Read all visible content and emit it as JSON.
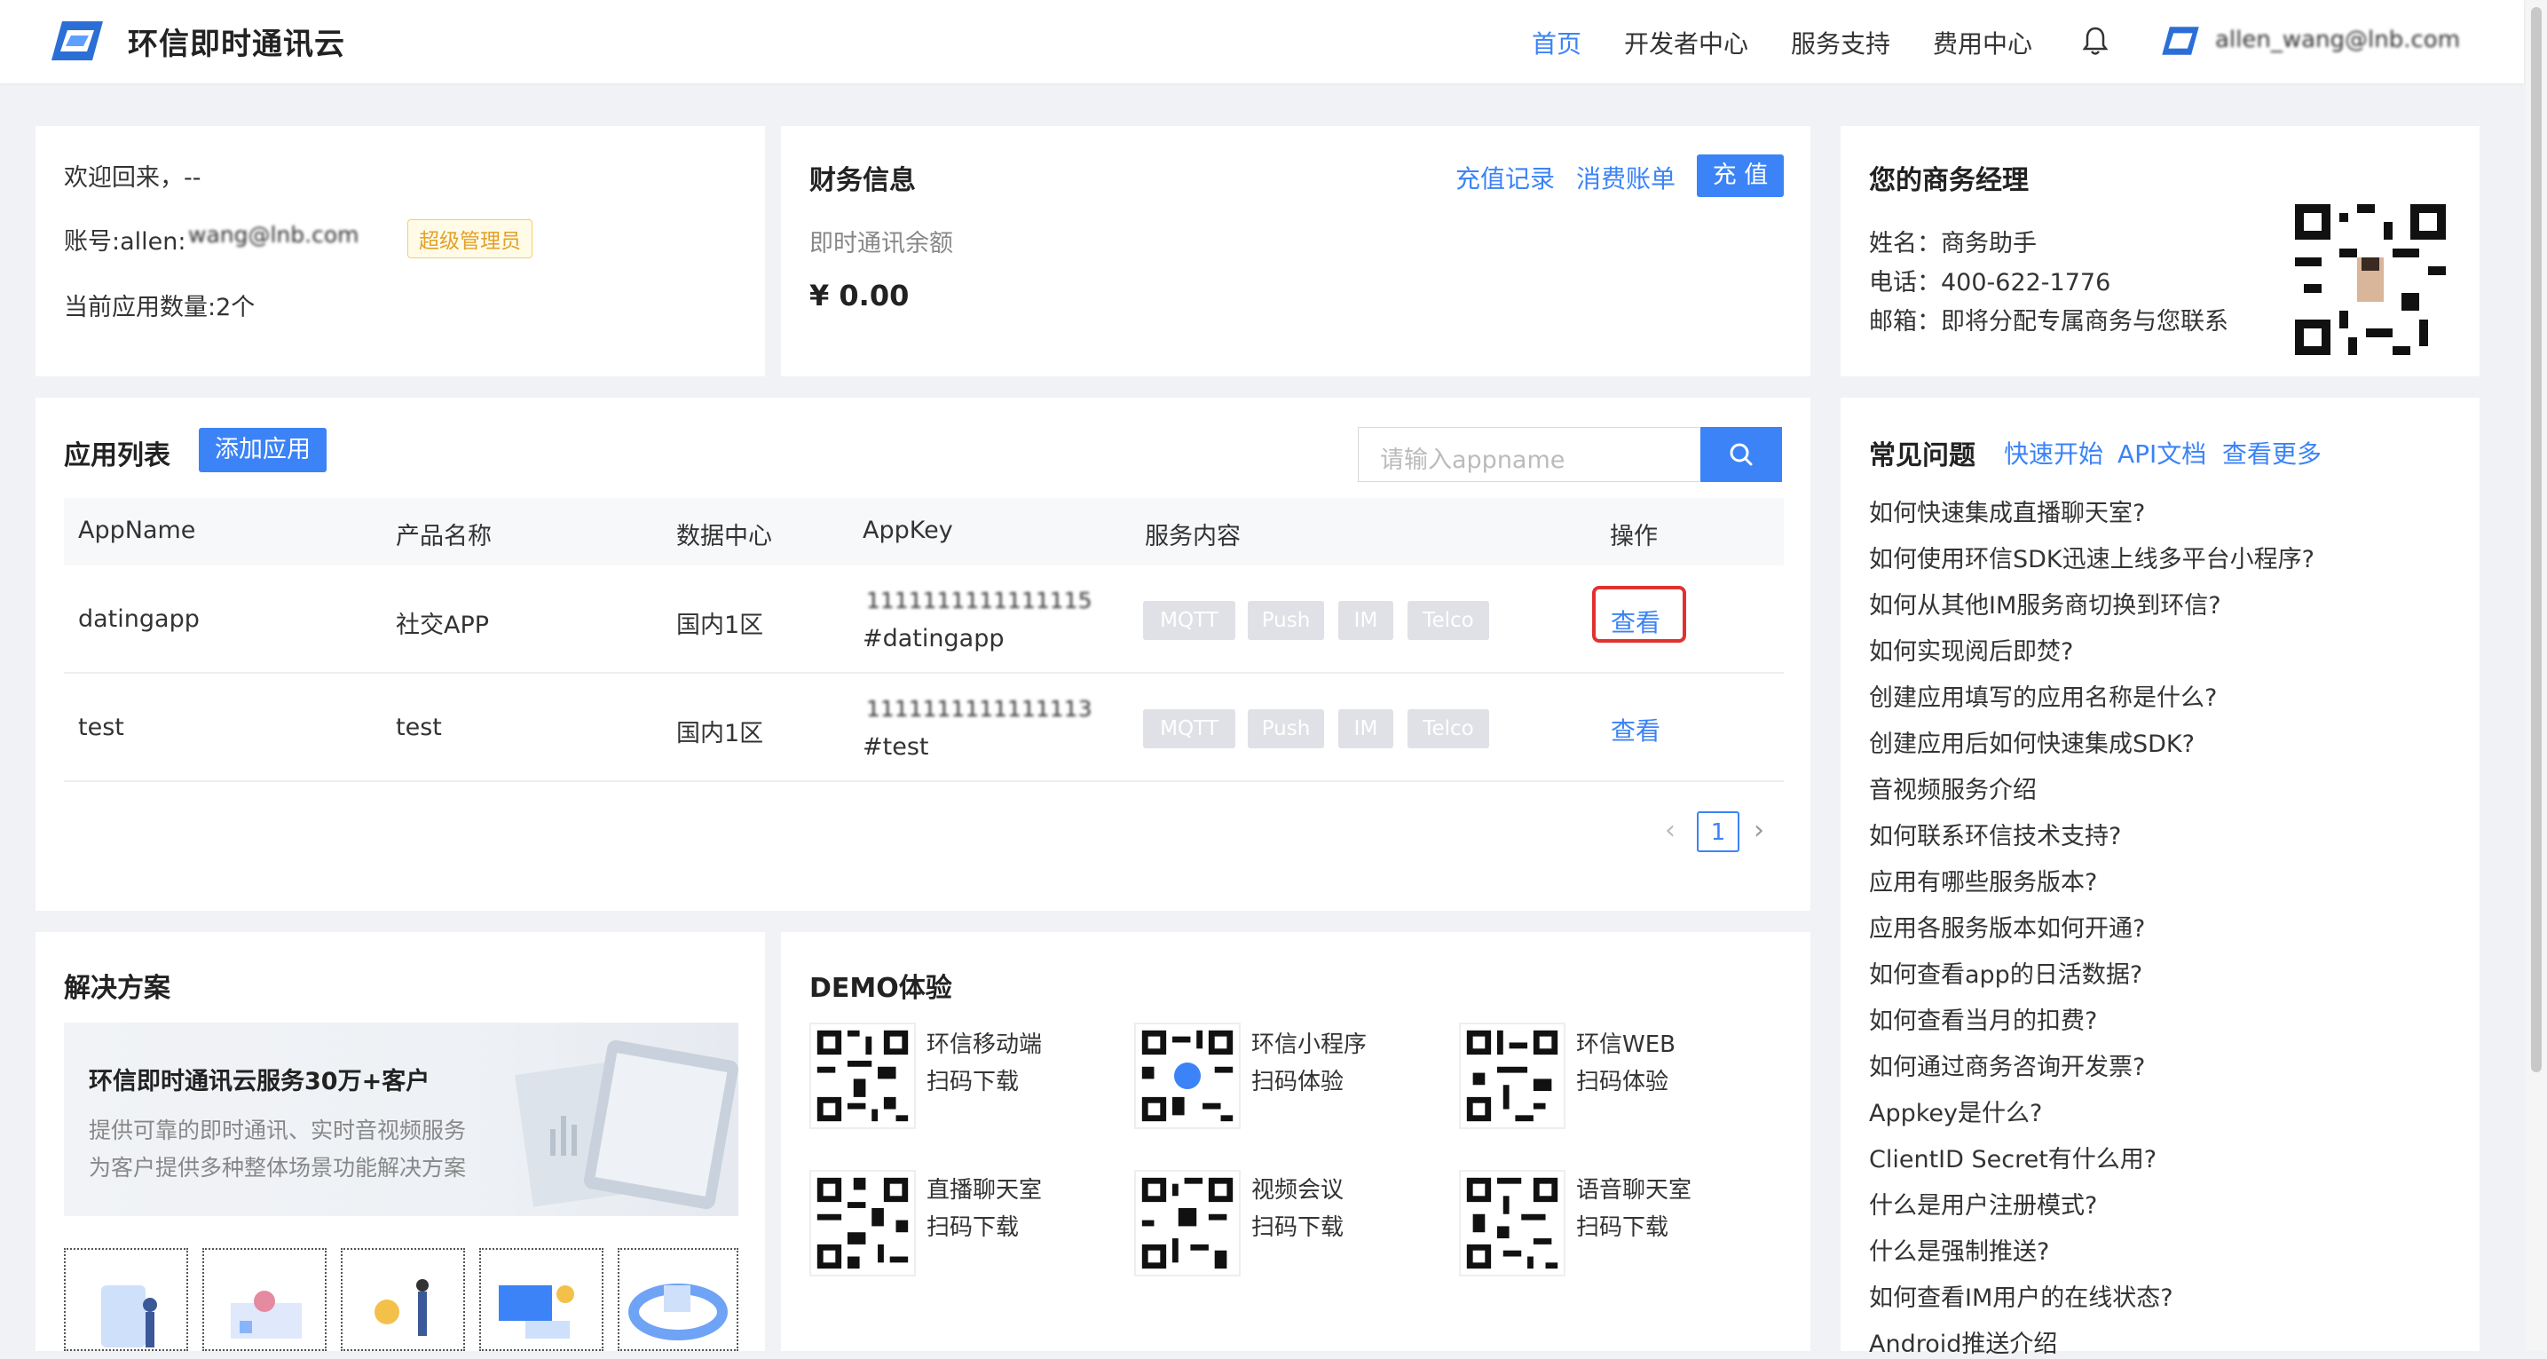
{
  "header": {
    "brand": "环信即时通讯云",
    "nav": [
      "首页",
      "开发者中心",
      "服务支持",
      "费用中心"
    ],
    "user": "allen_wang@lnb.com"
  },
  "welcome": {
    "greeting": "欢迎回来，--",
    "account_label": "账号:allen:",
    "account_value": "wang@lnb.com",
    "role_badge": "超级管理员",
    "app_count": "当前应用数量:2个"
  },
  "finance": {
    "title": "财务信息",
    "recharge_record": "充值记录",
    "bill": "消费账单",
    "recharge_button": "充 值",
    "balance_label": "即时通讯余额",
    "balance": "¥ 0.00"
  },
  "manager": {
    "title": "您的商务经理",
    "name": "姓名：商务助手",
    "phone": "电话：400-622-1776",
    "email": "邮箱：即将分配专属商务与您联系"
  },
  "apps": {
    "title": "应用列表",
    "add_button": "添加应用",
    "search_placeholder": "请输入appname",
    "columns": [
      "AppName",
      "产品名称",
      "数据中心",
      "AppKey",
      "服务内容",
      "操作"
    ],
    "rows": [
      {
        "name": "datingapp",
        "product": "社交APP",
        "dc": "国内1区",
        "key_line1": "1111111111111115",
        "key_line2": "#datingapp",
        "services": [
          "MQTT",
          "Push",
          "IM",
          "Telco"
        ],
        "action": "查看"
      },
      {
        "name": "test",
        "product": "test",
        "dc": "国内1区",
        "key_line1": "1111111111111113",
        "key_line2": "#test",
        "services": [
          "MQTT",
          "Push",
          "IM",
          "Telco"
        ],
        "action": "查看"
      }
    ],
    "page": "1"
  },
  "faq": {
    "title": "常见问题",
    "links": [
      "快速开始",
      "API文档",
      "查看更多"
    ],
    "items": [
      "如何快速集成直播聊天室?",
      "如何使用环信SDK迅速上线多平台小程序?",
      "如何从其他IM服务商切换到环信?",
      "如何实现阅后即焚?",
      "创建应用填写的应用名称是什么?",
      "创建应用后如何快速集成SDK?",
      "音视频服务介绍",
      "如何联系环信技术支持?",
      "应用有哪些服务版本?",
      "应用各服务版本如何开通?",
      "如何查看app的日活数据?",
      "如何查看当月的扣费?",
      "如何通过商务咨询开发票?",
      "Appkey是什么?",
      "ClientID Secret有什么用?",
      "什么是用户注册模式?",
      "什么是强制推送?",
      "如何查看IM用户的在线状态?",
      "Android推送介绍"
    ]
  },
  "solutions": {
    "title": "解决方案",
    "banner_title": "环信即时通讯云服务30万+客户",
    "banner_line1": "提供可靠的即时通讯、实时音视频服务",
    "banner_line2": "为客户提供多种整体场景功能解决方案"
  },
  "demo": {
    "title": "DEMO体验",
    "items": [
      {
        "name": "环信移动端",
        "action": "扫码下载"
      },
      {
        "name": "环信小程序",
        "action": "扫码体验"
      },
      {
        "name": "环信WEB",
        "action": "扫码体验"
      },
      {
        "name": "直播聊天室",
        "action": "扫码下载"
      },
      {
        "name": "视频会议",
        "action": "扫码下载"
      },
      {
        "name": "语音聊天室",
        "action": "扫码下载"
      }
    ]
  },
  "colors": {
    "primary": "#3b83f7",
    "highlight_border": "#e0322f",
    "badge": "#e3a02b"
  }
}
